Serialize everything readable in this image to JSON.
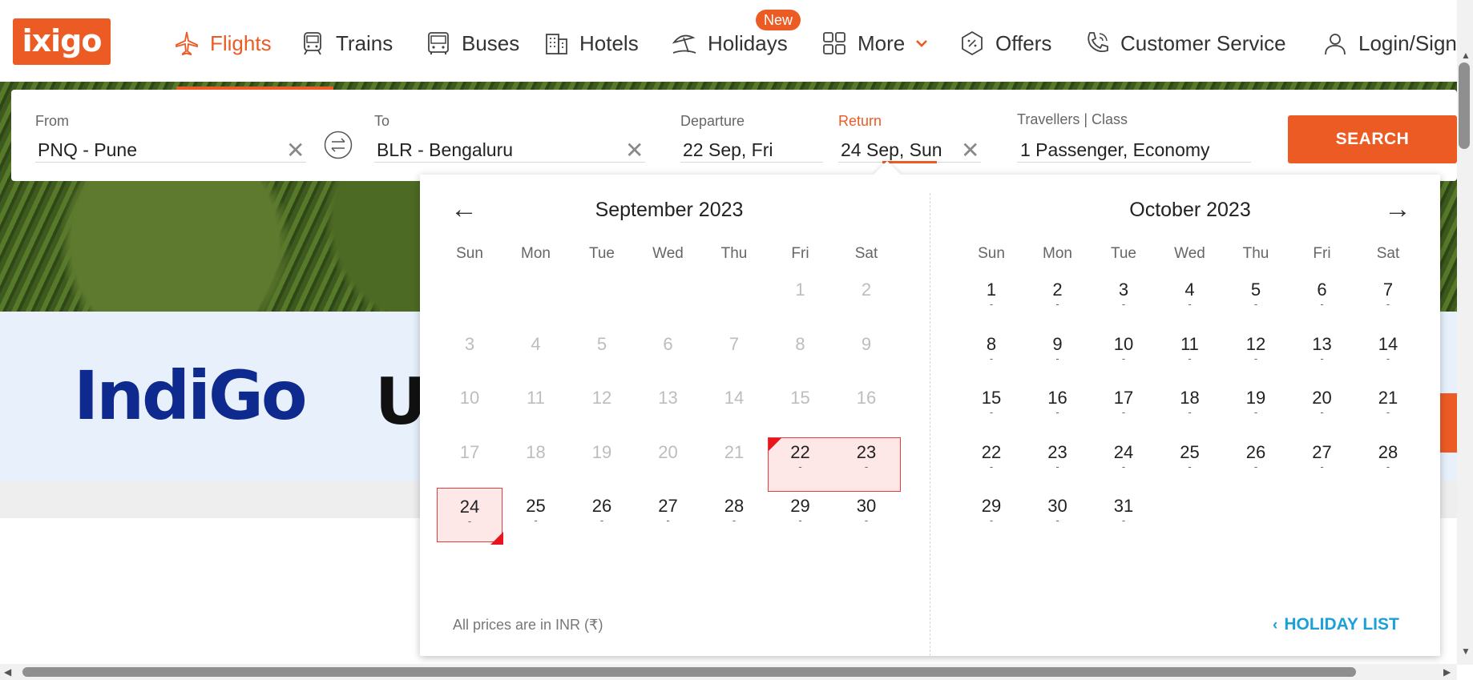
{
  "header": {
    "logo": "ixigo",
    "nav": [
      {
        "label": "Flights",
        "icon": "plane-icon"
      },
      {
        "label": "Trains",
        "icon": "train-icon"
      },
      {
        "label": "Buses",
        "icon": "bus-icon"
      },
      {
        "label": "Hotels",
        "icon": "building-icon"
      },
      {
        "label": "Holidays",
        "icon": "beach-umbrella-icon"
      },
      {
        "label": "More",
        "icon": "grid-icon"
      },
      {
        "label": "Offers",
        "icon": "discount-tag-icon"
      },
      {
        "label": "Customer Service",
        "icon": "phone-icon"
      },
      {
        "label": "Login/Sign",
        "icon": "user-icon"
      }
    ],
    "new_badge": "New",
    "accent": "#ec5b24"
  },
  "search": {
    "from_label": "From",
    "from_value": "PNQ - Pune",
    "to_label": "To",
    "to_value": "BLR - Bengaluru",
    "departure_label": "Departure",
    "departure_value": "22 Sep, Fri",
    "return_label": "Return",
    "return_value": "24 Sep, Sun",
    "travellers_label": "Travellers | Class",
    "travellers_value": "1 Passenger, Economy",
    "search_button": "SEARCH"
  },
  "airlines": {
    "indigo": "IndiGo",
    "partial": "U"
  },
  "calendar": {
    "weekdays": [
      "Sun",
      "Mon",
      "Tue",
      "Wed",
      "Thu",
      "Fri",
      "Sat"
    ],
    "months": [
      {
        "title": "September 2023",
        "first_weekday": 5,
        "days": 30,
        "disabled_until": 21,
        "selected": [
          22,
          23,
          24
        ]
      },
      {
        "title": "October 2023",
        "first_weekday": 0,
        "days": 31,
        "disabled_until": 0,
        "selected": []
      }
    ],
    "price_placeholder": "-",
    "note": "All prices are in INR (₹)",
    "holiday_list": "HOLIDAY LIST",
    "selection_color": "#e83b3b"
  }
}
